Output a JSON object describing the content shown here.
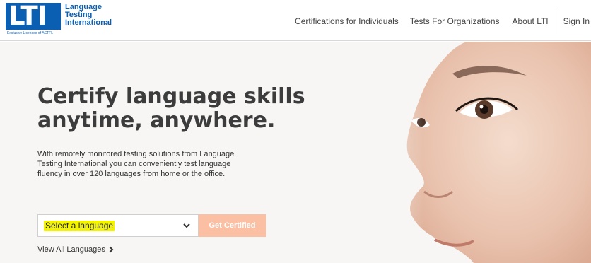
{
  "brand": {
    "logo_letters": "LTI",
    "name_lines": [
      "Language",
      "Testing",
      "International"
    ],
    "tagline": "Exclusive Licensee of ACTFL",
    "color": "#0b5fb3"
  },
  "nav": {
    "items": [
      {
        "label": "Certifications for Individuals"
      },
      {
        "label": "Tests For Organizations"
      },
      {
        "label": "About LTI"
      },
      {
        "label": "Sign In"
      }
    ]
  },
  "hero": {
    "title_lines": [
      "Certify language skills",
      "anytime, anywhere."
    ],
    "description": "With remotely monitored testing solutions from Language Testing International you can conveniently test language fluency in over 120 languages from home or the office.",
    "language_select": {
      "selected": "Select a language",
      "icon": "chevron-down-icon",
      "highlight_color": "#f4f400"
    },
    "cta_label": "Get Certified",
    "cta_color": "#fbc0a3",
    "view_all_label": "View All Languages",
    "view_all_icon": "chevron-right-icon"
  }
}
